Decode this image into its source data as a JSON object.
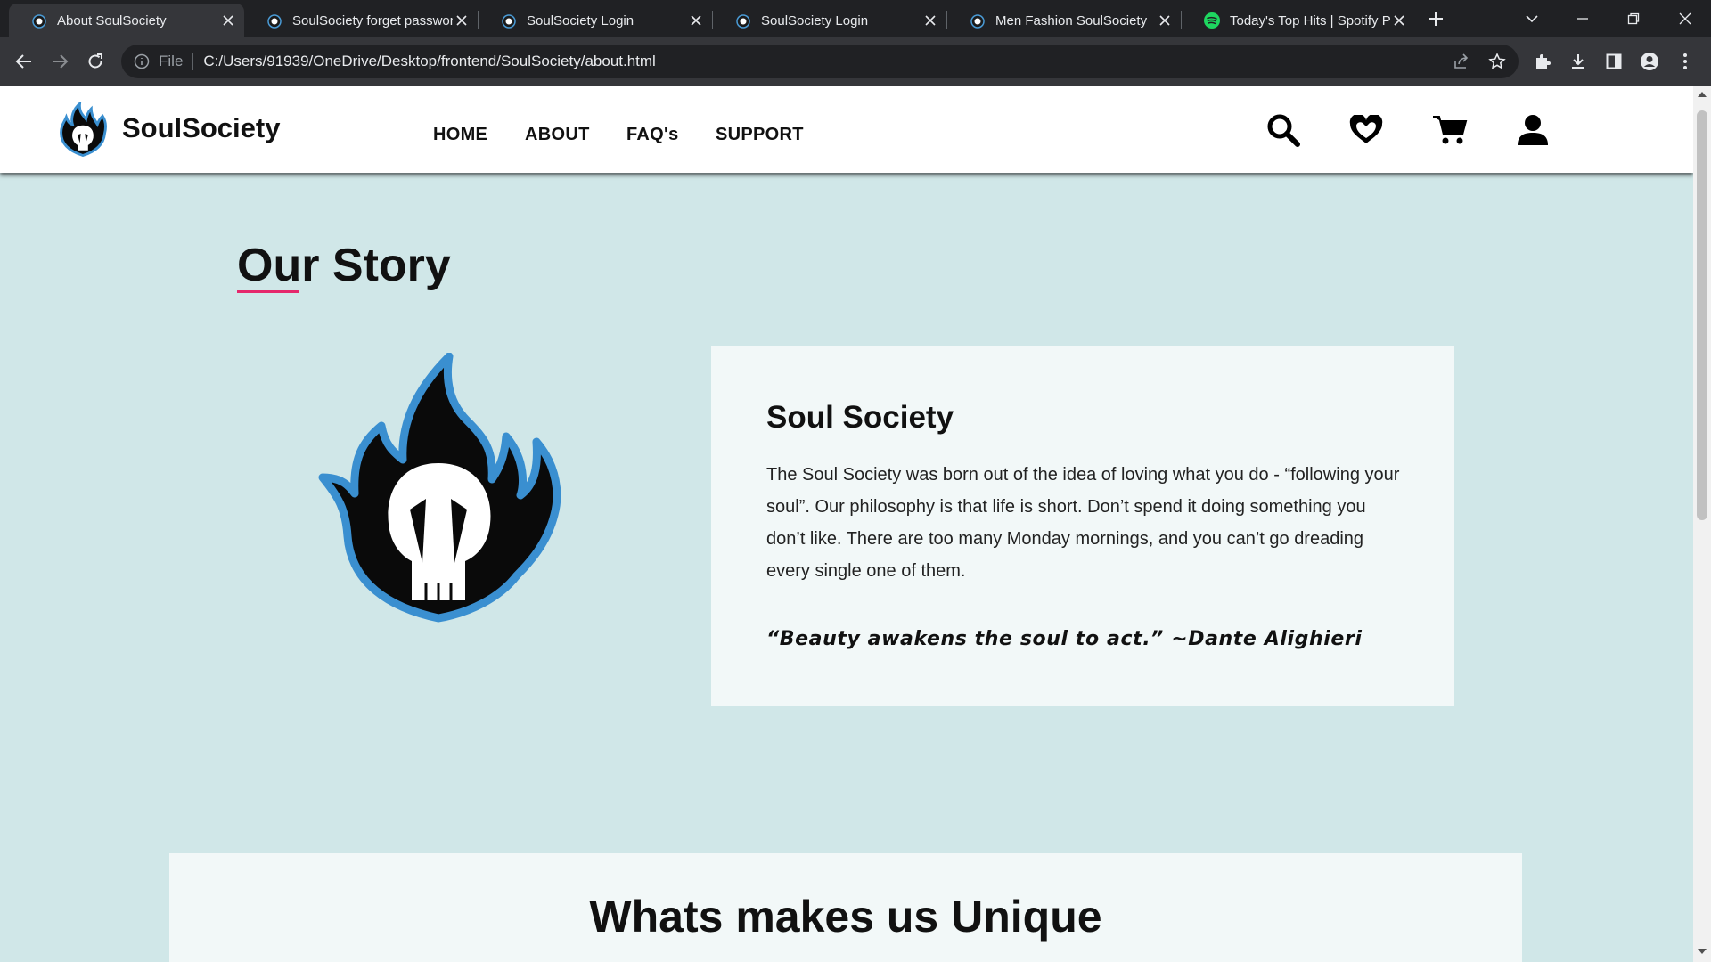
{
  "browser": {
    "tabs": [
      {
        "title": "About SoulSociety",
        "favicon": "soulsociety-favicon",
        "active": true
      },
      {
        "title": "SoulSociety forget password",
        "favicon": "soulsociety-favicon",
        "active": false
      },
      {
        "title": "SoulSociety Login",
        "favicon": "soulsociety-favicon",
        "active": false
      },
      {
        "title": "SoulSociety Login",
        "favicon": "soulsociety-favicon",
        "active": false
      },
      {
        "title": "Men Fashion SoulSociety",
        "favicon": "soulsociety-favicon",
        "active": false
      },
      {
        "title": "Today's Top Hits | Spotify Playlist",
        "favicon": "spotify-favicon",
        "active": false
      }
    ],
    "address_scheme": "File",
    "address_url": "C:/Users/91939/OneDrive/Desktop/frontend/SoulSociety/about.html",
    "icons": [
      "back-icon",
      "forward-icon",
      "reload-icon",
      "info-icon",
      "share-icon",
      "bookmark-star-icon",
      "extensions-icon",
      "download-icon",
      "side-panel-icon",
      "profile-icon",
      "menu-dots-icon",
      "new-tab-icon",
      "tab-search-icon",
      "minimize-icon",
      "restore-icon",
      "close-window-icon"
    ]
  },
  "site": {
    "brand": "SoulSociety",
    "nav": [
      "HOME",
      "ABOUT",
      "FAQ's",
      "SUPPORT"
    ],
    "header_icons": [
      "search-icon",
      "heart-icon",
      "cart-icon",
      "user-icon"
    ]
  },
  "story": {
    "heading": "Our Story",
    "card_title": "Soul Society",
    "card_text": "The Soul Society was born out of the idea of loving what you do - “following your soul”. Our philosophy is that life is short. Don’t spend it doing something you don’t like. There are too many Monday mornings, and you can’t go dreading every single one of them.",
    "quote": "“Beauty awakens the soul to act.” ~Dante Alighieri"
  },
  "unique": {
    "title": "Whats makes us Unique"
  },
  "colors": {
    "page_bg": "#d0e7e8",
    "card_bg": "#f2f8f8",
    "accent_underline": "#e5286c",
    "logo_blue": "#3a8fd0"
  }
}
